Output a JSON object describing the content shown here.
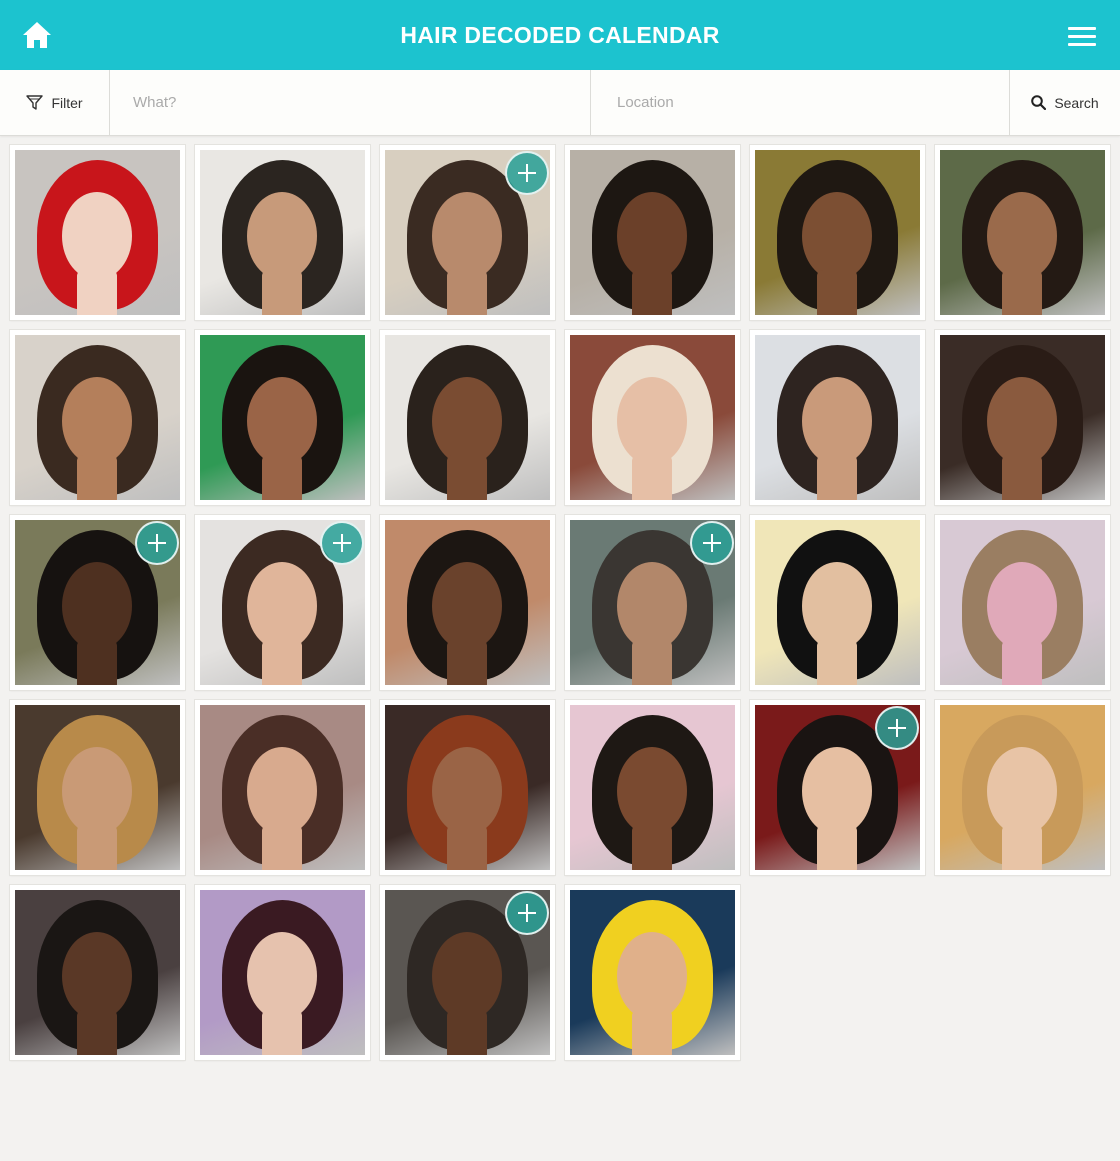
{
  "header": {
    "title": "HAIR DECODED CALENDAR",
    "background": "#1cc3cf"
  },
  "searchbar": {
    "filter_label": "Filter",
    "what_placeholder": "What?",
    "location_placeholder": "Location",
    "search_label": "Search"
  },
  "photos": [
    {
      "name": "red-wavy-hair",
      "bg": "#c8c4c0",
      "hair": "#c8151b",
      "skin": "#f0d2c2",
      "add": false
    },
    {
      "name": "long-locs",
      "bg": "#e9e7e3",
      "hair": "#2b2520",
      "skin": "#c79a7a",
      "add": false
    },
    {
      "name": "side-braid",
      "bg": "#d8cfc0",
      "hair": "#3a2b22",
      "skin": "#b88a6c",
      "add": true
    },
    {
      "name": "natural-afro-smile",
      "bg": "#b7b0a6",
      "hair": "#1d1712",
      "skin": "#6b4029",
      "add": false
    },
    {
      "name": "curly-twist-out",
      "bg": "#8a7a35",
      "hair": "#1f1812",
      "skin": "#7c4f33",
      "add": false
    },
    {
      "name": "crown-braid",
      "bg": "#5d6a48",
      "hair": "#241a14",
      "skin": "#9a6a4b",
      "add": false
    },
    {
      "name": "cornrows-man",
      "bg": "#d8d2ca",
      "hair": "#3a2a20",
      "skin": "#b47f5b",
      "add": false
    },
    {
      "name": "braids-green-bg",
      "bg": "#2f9a55",
      "hair": "#1a1410",
      "skin": "#9a6447",
      "add": false
    },
    {
      "name": "heart-cornrows",
      "bg": "#e8e6e2",
      "hair": "#2a221c",
      "skin": "#7a4c32",
      "add": false
    },
    {
      "name": "platinum-pixie",
      "bg": "#8a4a3a",
      "hair": "#ece0d0",
      "skin": "#e6bfa6",
      "add": false
    },
    {
      "name": "pompadour-man",
      "bg": "#dcdfe3",
      "hair": "#2e2420",
      "skin": "#c99a7a",
      "add": false
    },
    {
      "name": "crown-braid-side",
      "bg": "#3a2c26",
      "hair": "#2a1c16",
      "skin": "#8a5a3e",
      "add": false
    },
    {
      "name": "updo-crowd",
      "bg": "#7a7a5a",
      "hair": "#161210",
      "skin": "#4e3020",
      "add": true
    },
    {
      "name": "brunette-lob",
      "bg": "#e4e2e0",
      "hair": "#3c2a22",
      "skin": "#e0b59a",
      "add": true
    },
    {
      "name": "afro-mohawk",
      "bg": "#c08a6a",
      "hair": "#1c1612",
      "skin": "#6a422c",
      "add": false
    },
    {
      "name": "shaved-design",
      "bg": "#6a7a74",
      "hair": "#3a3632",
      "skin": "#b2876a",
      "add": true
    },
    {
      "name": "sleek-bob",
      "bg": "#f0e6b8",
      "hair": "#111111",
      "skin": "#e2bfa0",
      "add": false
    },
    {
      "name": "kids-braid",
      "bg": "#d8c9d4",
      "hair": "#9a7e62",
      "skin": "#e0a9b9",
      "add": false
    },
    {
      "name": "golden-curls",
      "bg": "#4a3a2e",
      "hair": "#b88a4a",
      "skin": "#c99a76",
      "add": false
    },
    {
      "name": "pixie-bob",
      "bg": "#a88a84",
      "hair": "#4a2e26",
      "skin": "#d8aa8e",
      "add": false
    },
    {
      "name": "auburn-bob",
      "bg": "#3a2a26",
      "hair": "#8a3a1c",
      "skin": "#9a6446",
      "add": false
    },
    {
      "name": "twist-updo",
      "bg": "#e6c6d2",
      "hair": "#1e1814",
      "skin": "#7a4a30",
      "add": false
    },
    {
      "name": "flower-curls",
      "bg": "#7a1a1a",
      "hair": "#1a1412",
      "skin": "#e6bfa2",
      "add": true
    },
    {
      "name": "long-straight-blonde",
      "bg": "#d8a860",
      "hair": "#c89a5a",
      "skin": "#e8c4a6",
      "add": false
    },
    {
      "name": "braided-mohawk",
      "bg": "#4a4040",
      "hair": "#1a1614",
      "skin": "#5a3826",
      "add": false
    },
    {
      "name": "finger-waves",
      "bg": "#b29ac6",
      "hair": "#3a1a22",
      "skin": "#e6c2ae",
      "add": false
    },
    {
      "name": "fade-cut",
      "bg": "#5a5652",
      "hair": "#2e2824",
      "skin": "#5e3a26",
      "add": true
    },
    {
      "name": "blue-yellow-hair",
      "bg": "#1a3a5a",
      "hair": "#f0d020",
      "skin": "#e0b08a",
      "add": false
    }
  ]
}
